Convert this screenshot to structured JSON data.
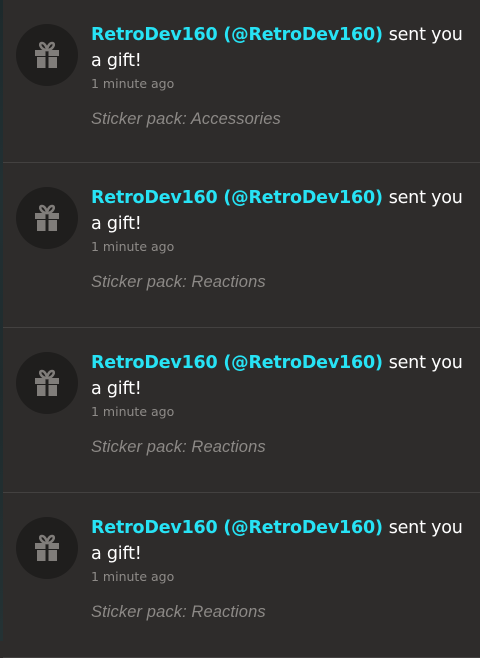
{
  "notifications": [
    {
      "sender": "RetroDev160 (@RetroDev160)",
      "action": "sent you a gift!",
      "time": "1 minute ago",
      "detail": "Sticker pack: Accessories",
      "icon": "gift-icon"
    },
    {
      "sender": "RetroDev160 (@RetroDev160)",
      "action": "sent you a gift!",
      "time": "1 minute ago",
      "detail": "Sticker pack: Reactions",
      "icon": "gift-icon"
    },
    {
      "sender": "RetroDev160 (@RetroDev160)",
      "action": "sent you a gift!",
      "time": "1 minute ago",
      "detail": "Sticker pack: Reactions",
      "icon": "gift-icon"
    },
    {
      "sender": "RetroDev160 (@RetroDev160)",
      "action": "sent you a gift!",
      "time": "1 minute ago",
      "detail": "Sticker pack: Reactions",
      "icon": "gift-icon"
    }
  ],
  "colors": {
    "background": "#2e2c2b",
    "sender": "#27e3f5",
    "text": "#ffffff",
    "muted": "#8e8b88",
    "avatar_bg": "#1f1e1d",
    "divider": "#434140"
  }
}
